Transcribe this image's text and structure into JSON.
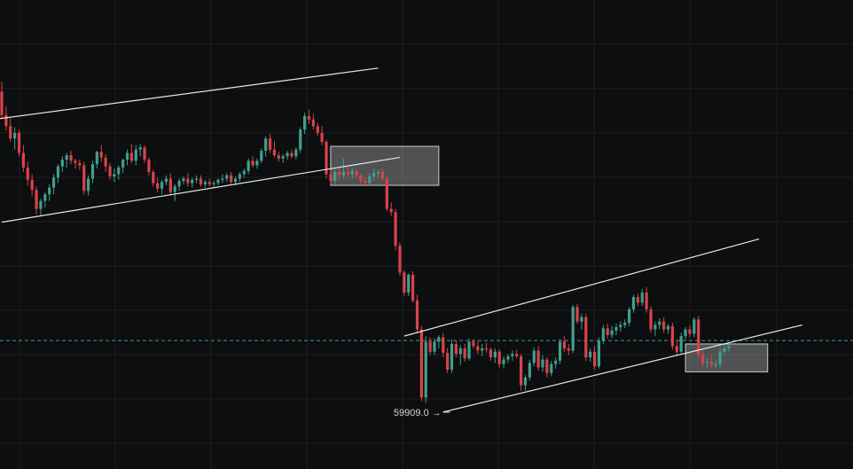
{
  "chart_data": {
    "type": "candlestick",
    "title": "",
    "xlabel": "",
    "ylabel": "",
    "ylim": [
      59400,
      63600
    ],
    "grid": true,
    "colors": {
      "background": "#0d0e10",
      "grid": "#1b1d21",
      "up": "#3fa08c",
      "down": "#d9434b",
      "wick": "#c9c9c9",
      "trendline": "#e6e6e6",
      "current_price_line": "#3d9e8f",
      "zone_fill": "#ffffff"
    },
    "current_price": 60550,
    "low_marker": {
      "text": "59909.0",
      "value": 59909.0,
      "arrow": "→"
    },
    "trendlines": [
      {
        "name": "upper-channel-1",
        "from": [
          -2,
          62530
        ],
        "to": [
          87,
          62990
        ]
      },
      {
        "name": "lower-channel-1",
        "from": [
          0,
          61610
        ],
        "to": [
          92,
          62190
        ]
      },
      {
        "name": "upper-channel-2",
        "from": [
          93,
          60590
        ],
        "to": [
          175,
          61460
        ]
      },
      {
        "name": "lower-channel-2",
        "from": [
          102,
          59910
        ],
        "to": [
          185,
          60690
        ]
      }
    ],
    "zones": [
      {
        "name": "breakdown-zone-1",
        "x_from": 76,
        "x_to": 101,
        "y_from": 61940,
        "y_to": 62290
      },
      {
        "name": "breakdown-zone-2",
        "x_from": 158,
        "x_to": 177,
        "y_from": 60270,
        "y_to": 60520
      }
    ],
    "candles": [
      [
        62780,
        62870,
        62540,
        62570
      ],
      [
        62570,
        62650,
        62430,
        62470
      ],
      [
        62470,
        62540,
        62330,
        62360
      ],
      [
        62360,
        62460,
        62260,
        62410
      ],
      [
        62410,
        62440,
        62200,
        62230
      ],
      [
        62230,
        62300,
        62060,
        62100
      ],
      [
        62100,
        62150,
        61940,
        61990
      ],
      [
        61990,
        62040,
        61850,
        61900
      ],
      [
        61900,
        61930,
        61680,
        61730
      ],
      [
        61730,
        61820,
        61660,
        61800
      ],
      [
        61800,
        61880,
        61740,
        61860
      ],
      [
        61860,
        61950,
        61800,
        61920
      ],
      [
        61920,
        62040,
        61860,
        62010
      ],
      [
        62010,
        62130,
        61960,
        62110
      ],
      [
        62110,
        62200,
        62060,
        62170
      ],
      [
        62170,
        62230,
        62100,
        62210
      ],
      [
        62210,
        62250,
        62130,
        62160
      ],
      [
        62160,
        62180,
        62090,
        62140
      ],
      [
        62140,
        62170,
        62080,
        62120
      ],
      [
        62120,
        62150,
        61860,
        61890
      ],
      [
        61890,
        62030,
        61850,
        62000
      ],
      [
        62000,
        62160,
        61960,
        62130
      ],
      [
        62130,
        62250,
        62090,
        62240
      ],
      [
        62240,
        62300,
        62150,
        62190
      ],
      [
        62190,
        62220,
        62060,
        62110
      ],
      [
        62110,
        62140,
        61990,
        62020
      ],
      [
        62020,
        62090,
        61970,
        62040
      ],
      [
        62040,
        62120,
        61990,
        62100
      ],
      [
        62100,
        62180,
        62050,
        62170
      ],
      [
        62170,
        62260,
        62120,
        62230
      ],
      [
        62230,
        62310,
        62140,
        62160
      ],
      [
        62160,
        62300,
        62120,
        62260
      ],
      [
        62260,
        62310,
        62200,
        62280
      ],
      [
        62280,
        62300,
        62140,
        62170
      ],
      [
        62170,
        62190,
        62030,
        62060
      ],
      [
        62060,
        62080,
        61930,
        61960
      ],
      [
        61960,
        62010,
        61880,
        61910
      ],
      [
        61910,
        61990,
        61860,
        61970
      ],
      [
        61970,
        62030,
        61940,
        62000
      ],
      [
        62000,
        62050,
        61850,
        61880
      ],
      [
        61880,
        61950,
        61800,
        61930
      ],
      [
        61930,
        62000,
        61890,
        61980
      ],
      [
        61980,
        62020,
        61950,
        62000
      ],
      [
        62000,
        62050,
        61930,
        61960
      ],
      [
        61960,
        62010,
        61920,
        61990
      ],
      [
        61990,
        62030,
        61960,
        62000
      ],
      [
        62000,
        62030,
        61930,
        61950
      ],
      [
        61950,
        61990,
        61920,
        61970
      ],
      [
        61970,
        62000,
        61930,
        61950
      ],
      [
        61950,
        61980,
        61920,
        61960
      ],
      [
        61960,
        62000,
        61940,
        61990
      ],
      [
        61990,
        62040,
        61960,
        62000
      ],
      [
        62000,
        62050,
        61970,
        62030
      ],
      [
        62030,
        62060,
        61950,
        61970
      ],
      [
        61970,
        62020,
        61940,
        62000
      ],
      [
        62000,
        62060,
        61970,
        62040
      ],
      [
        62040,
        62090,
        62010,
        62070
      ],
      [
        62070,
        62180,
        62040,
        62160
      ],
      [
        62160,
        62200,
        62100,
        62120
      ],
      [
        62120,
        62180,
        62090,
        62160
      ],
      [
        62160,
        62270,
        62140,
        62250
      ],
      [
        62250,
        62380,
        62200,
        62360
      ],
      [
        62360,
        62400,
        62230,
        62260
      ],
      [
        62260,
        62340,
        62190,
        62210
      ],
      [
        62210,
        62240,
        62150,
        62180
      ],
      [
        62180,
        62220,
        62140,
        62200
      ],
      [
        62200,
        62250,
        62170,
        62230
      ],
      [
        62230,
        62260,
        62180,
        62200
      ],
      [
        62200,
        62280,
        62170,
        62260
      ],
      [
        62260,
        62460,
        62230,
        62440
      ],
      [
        62440,
        62590,
        62400,
        62560
      ],
      [
        62560,
        62620,
        62490,
        62530
      ],
      [
        62530,
        62580,
        62440,
        62470
      ],
      [
        62470,
        62500,
        62380,
        62410
      ],
      [
        62410,
        62470,
        62300,
        62330
      ],
      [
        62330,
        62350,
        62000,
        62040
      ],
      [
        62040,
        62080,
        61950,
        61980
      ],
      [
        61980,
        62090,
        61950,
        62060
      ],
      [
        62060,
        62110,
        61990,
        62030
      ],
      [
        62030,
        62180,
        62000,
        62060
      ],
      [
        62060,
        62110,
        62010,
        62040
      ],
      [
        62040,
        62100,
        62000,
        62070
      ],
      [
        62070,
        62080,
        62010,
        62030
      ],
      [
        62030,
        62050,
        61950,
        61980
      ],
      [
        61980,
        62010,
        61930,
        61960
      ],
      [
        61960,
        62050,
        61940,
        62020
      ],
      [
        62020,
        62090,
        61980,
        62050
      ],
      [
        62050,
        62080,
        62010,
        62060
      ],
      [
        62060,
        62090,
        61980,
        62000
      ],
      [
        62000,
        62020,
        61710,
        61730
      ],
      [
        61730,
        61790,
        61670,
        61700
      ],
      [
        61700,
        61730,
        61360,
        61400
      ],
      [
        61400,
        61430,
        61130,
        61160
      ],
      [
        61160,
        61180,
        60950,
        60980
      ],
      [
        60980,
        61150,
        60950,
        61140
      ],
      [
        61140,
        61170,
        60890,
        60910
      ],
      [
        60910,
        60960,
        60620,
        60650
      ],
      [
        60650,
        60680,
        60010,
        60040
      ],
      [
        60040,
        60590,
        59990,
        60540
      ],
      [
        60540,
        60580,
        60420,
        60450
      ],
      [
        60450,
        60570,
        60420,
        60540
      ],
      [
        60540,
        60600,
        60480,
        60580
      ],
      [
        60580,
        60620,
        60400,
        60440
      ],
      [
        60440,
        60480,
        60260,
        60290
      ],
      [
        60290,
        60560,
        60260,
        60520
      ],
      [
        60520,
        60550,
        60400,
        60430
      ],
      [
        60430,
        60510,
        60330,
        60480
      ],
      [
        60480,
        60520,
        60360,
        60390
      ],
      [
        60390,
        60570,
        60370,
        60540
      ],
      [
        60540,
        60560,
        60480,
        60500
      ],
      [
        60500,
        60550,
        60430,
        60460
      ],
      [
        60460,
        60520,
        60410,
        60480
      ],
      [
        60480,
        60530,
        60440,
        60470
      ],
      [
        60470,
        60490,
        60370,
        60400
      ],
      [
        60400,
        60480,
        60350,
        60450
      ],
      [
        60450,
        60470,
        60310,
        60340
      ],
      [
        60340,
        60410,
        60300,
        60380
      ],
      [
        60380,
        60430,
        60350,
        60410
      ],
      [
        60410,
        60460,
        60370,
        60430
      ],
      [
        60430,
        60470,
        60390,
        60410
      ],
      [
        60410,
        60430,
        60100,
        60150
      ],
      [
        60150,
        60240,
        60100,
        60220
      ],
      [
        60220,
        60380,
        60190,
        60350
      ],
      [
        60350,
        60490,
        60320,
        60460
      ],
      [
        60460,
        60500,
        60280,
        60310
      ],
      [
        60310,
        60420,
        60270,
        60380
      ],
      [
        60380,
        60400,
        60220,
        60260
      ],
      [
        60260,
        60370,
        60230,
        60340
      ],
      [
        60340,
        60400,
        60300,
        60370
      ],
      [
        60370,
        60560,
        60340,
        60540
      ],
      [
        60540,
        60590,
        60450,
        60480
      ],
      [
        60480,
        60520,
        60420,
        60460
      ],
      [
        60460,
        60870,
        60440,
        60850
      ],
      [
        60850,
        60880,
        60700,
        60720
      ],
      [
        60720,
        60790,
        60650,
        60760
      ],
      [
        60760,
        60790,
        60370,
        60400
      ],
      [
        60400,
        60480,
        60360,
        60450
      ],
      [
        60450,
        60500,
        60290,
        60320
      ],
      [
        60320,
        60580,
        60300,
        60550
      ],
      [
        60550,
        60690,
        60520,
        60660
      ],
      [
        60660,
        60700,
        60570,
        60600
      ],
      [
        60600,
        60680,
        60570,
        60640
      ],
      [
        60640,
        60700,
        60600,
        60670
      ],
      [
        60670,
        60720,
        60630,
        60690
      ],
      [
        60690,
        60740,
        60660,
        60710
      ],
      [
        60710,
        60850,
        60680,
        60830
      ],
      [
        60830,
        60960,
        60800,
        60940
      ],
      [
        60940,
        60970,
        60860,
        60890
      ],
      [
        60890,
        61010,
        60860,
        60980
      ],
      [
        60980,
        61030,
        60800,
        60830
      ],
      [
        60830,
        60860,
        60620,
        60650
      ],
      [
        60650,
        60720,
        60590,
        60690
      ],
      [
        60690,
        60750,
        60650,
        60720
      ],
      [
        60720,
        60760,
        60620,
        60650
      ],
      [
        60650,
        60700,
        60610,
        60680
      ],
      [
        60680,
        60710,
        60470,
        60500
      ],
      [
        60500,
        60560,
        60420,
        60450
      ],
      [
        60450,
        60620,
        60420,
        60590
      ],
      [
        60590,
        60670,
        60560,
        60650
      ],
      [
        60650,
        60690,
        60580,
        60610
      ],
      [
        60610,
        60760,
        60580,
        60740
      ],
      [
        60740,
        60770,
        60390,
        60420
      ],
      [
        60420,
        60460,
        60310,
        60350
      ],
      [
        60350,
        60400,
        60300,
        60360
      ],
      [
        60360,
        60420,
        60310,
        60330
      ],
      [
        60330,
        60380,
        60300,
        60340
      ],
      [
        60340,
        60480,
        60310,
        60450
      ],
      [
        60450,
        60520,
        60420,
        60480
      ],
      [
        60480,
        60530,
        60450,
        60500
      ]
    ]
  }
}
